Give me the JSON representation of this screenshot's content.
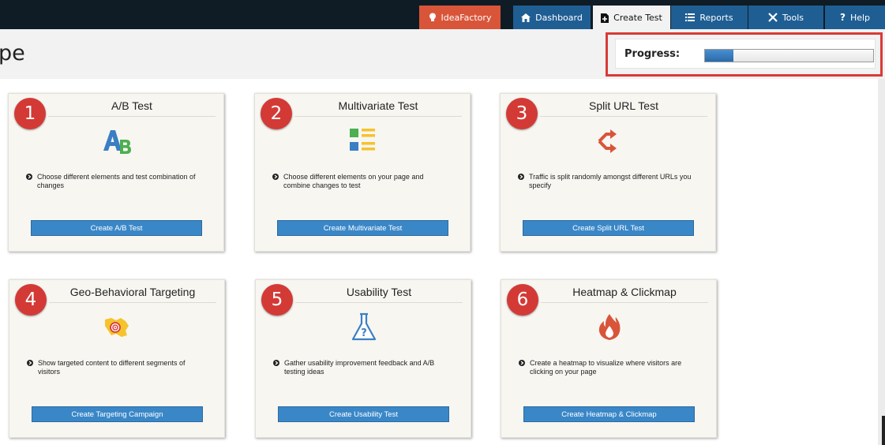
{
  "nav": {
    "ideafactory": "IdeaFactory",
    "dashboard": "Dashboard",
    "create_test": "Create Test",
    "reports": "Reports",
    "tools": "Tools",
    "help": "Help"
  },
  "page": {
    "title": "pe"
  },
  "progress": {
    "label": "Progress:",
    "value_fraction": 0.17
  },
  "colors": {
    "brand_red": "#d9553a",
    "nav_blue": "#1f5e93",
    "button_blue": "#3a87c8",
    "badge_red": "#d33a36"
  },
  "cards": [
    {
      "number": "1",
      "title": "A/B Test",
      "icon": "ab-letters-icon",
      "description": "Choose different elements and test combination of changes",
      "button": "Create A/B Test"
    },
    {
      "number": "2",
      "title": "Multivariate Test",
      "icon": "multivariate-grid-icon",
      "description": "Choose different elements on your page and combine changes to test",
      "button": "Create Multivariate Test"
    },
    {
      "number": "3",
      "title": "Split URL Test",
      "icon": "split-arrows-icon",
      "description": "Traffic is split randomly amongst different URLs you specify",
      "button": "Create Split URL Test"
    },
    {
      "number": "4",
      "title": "Geo-Behavioral Targeting",
      "icon": "map-target-icon",
      "description": "Show targeted content to different segments of visitors",
      "button": "Create Targeting Campaign"
    },
    {
      "number": "5",
      "title": "Usability Test",
      "icon": "flask-question-icon",
      "description": "Gather usability improvement feedback and A/B testing ideas",
      "button": "Create Usability Test"
    },
    {
      "number": "6",
      "title": "Heatmap & Clickmap",
      "icon": "flame-icon",
      "description": "Create a heatmap to visualize where visitors are clicking on your page",
      "button": "Create Heatmap & Clickmap"
    }
  ]
}
